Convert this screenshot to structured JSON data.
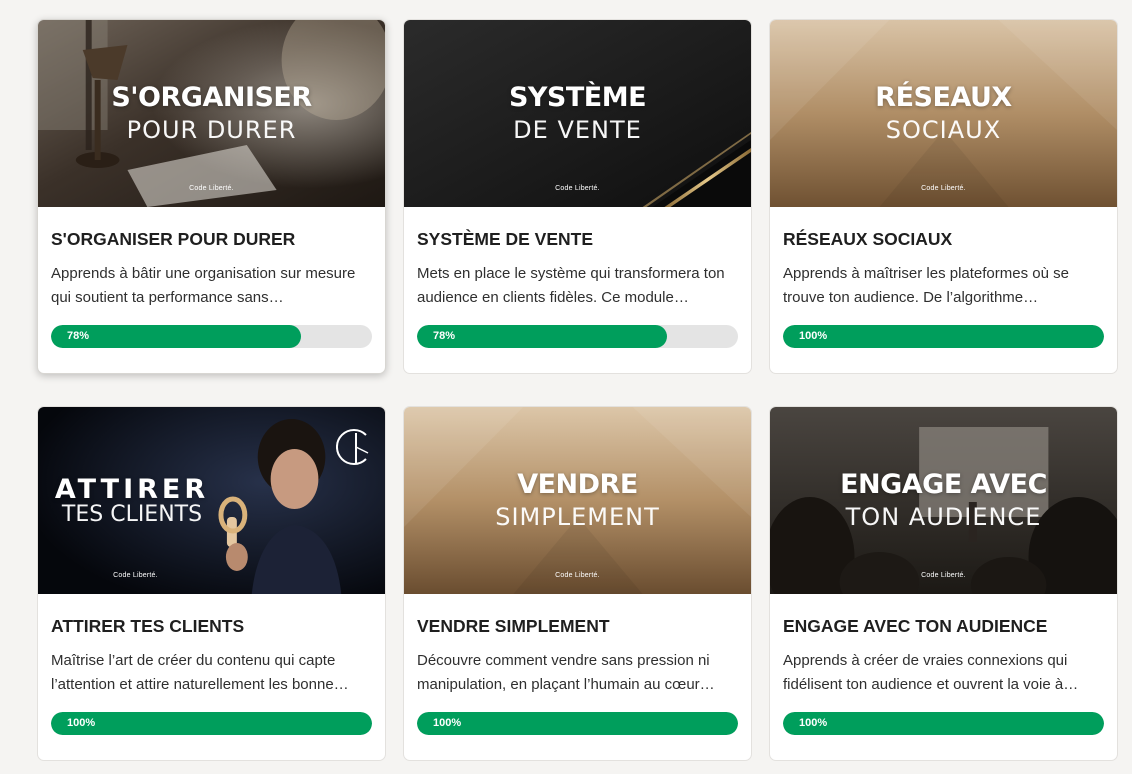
{
  "brand_label": "Code Liberté.",
  "accent_color": "#009e5c",
  "track_color": "#e4e4e4",
  "courses": [
    {
      "thumb_title": "S'ORGANISER",
      "thumb_subtitle": "POUR DURER",
      "title": "S'ORGANISER POUR DURER",
      "description": "Apprends à bâtir une organisation sur mesure qui soutient ta performance sans…",
      "progress": 78,
      "progress_label": "78%"
    },
    {
      "thumb_title": "SYSTÈME",
      "thumb_subtitle": "DE VENTE",
      "title": "SYSTÈME DE VENTE",
      "description": "Mets en place le système qui transformera ton audience en clients fidèles. Ce module…",
      "progress": 78,
      "progress_label": "78%"
    },
    {
      "thumb_title": "RÉSEAUX",
      "thumb_subtitle": "SOCIAUX",
      "title": "RÉSEAUX SOCIAUX",
      "description": "Apprends à maîtriser les plateformes où se trouve ton audience. De l’algorithme…",
      "progress": 100,
      "progress_label": "100%"
    },
    {
      "thumb_title": "ATTIRER",
      "thumb_subtitle": "TES CLIENTS",
      "title": "ATTIRER TES CLIENTS",
      "description": "Maîtrise l’art de créer du contenu qui capte l’attention et attire naturellement les bonne…",
      "progress": 100,
      "progress_label": "100%"
    },
    {
      "thumb_title": "VENDRE",
      "thumb_subtitle": "SIMPLEMENT",
      "title": "VENDRE SIMPLEMENT",
      "description": "Découvre comment vendre sans pression ni manipulation, en plaçant l’humain au cœur…",
      "progress": 100,
      "progress_label": "100%"
    },
    {
      "thumb_title": "ENGAGE AVEC",
      "thumb_subtitle": "TON AUDIENCE",
      "title": "ENGAGE AVEC TON AUDIENCE",
      "description": "Apprends à créer de vraies connexions qui fidélisent ton audience et ouvrent la voie à…",
      "progress": 100,
      "progress_label": "100%"
    }
  ]
}
